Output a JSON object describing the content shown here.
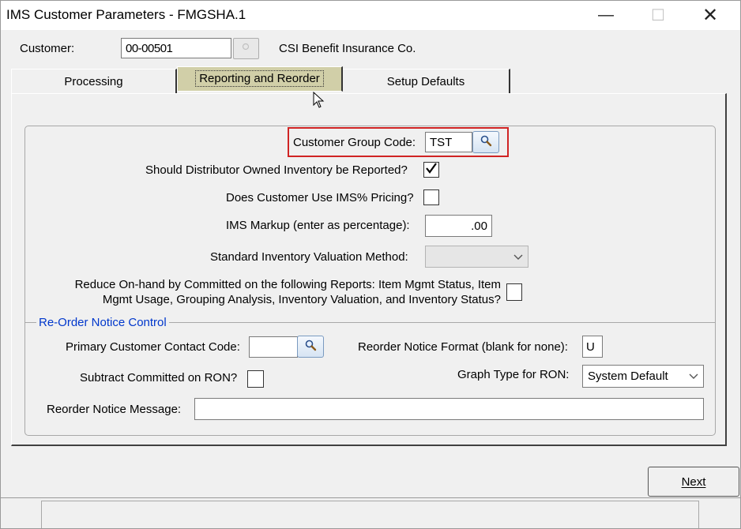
{
  "window": {
    "title": "IMS Customer Parameters - FMGSHA.1",
    "minimize_glyph": "—",
    "maximize_glyph": "☐",
    "close_glyph": "✕"
  },
  "customer": {
    "label": "Customer:",
    "code": "00-00501",
    "name": "CSI Benefit Insurance Co."
  },
  "tabs": [
    {
      "label": "Processing",
      "active": false
    },
    {
      "label": "Reporting and Reorder",
      "active": true
    },
    {
      "label": "Setup Defaults",
      "active": false
    }
  ],
  "form": {
    "customer_group_code_label": "Customer Group Code:",
    "customer_group_code_value": "TST",
    "distributor_owned_label": "Should Distributor Owned Inventory be Reported?",
    "distributor_owned_checked": true,
    "ims_pricing_label": "Does Customer Use IMS% Pricing?",
    "ims_pricing_checked": false,
    "ims_markup_label": "IMS Markup (enter as percentage):",
    "ims_markup_value": ".00",
    "valuation_method_label": "Standard Inventory Valuation Method:",
    "valuation_method_value": "",
    "reduce_onhand_label_line1": "Reduce On-hand by Committed on the following Reports: Item Mgmt Status, Item",
    "reduce_onhand_label_line2": "Mgmt Usage, Grouping Analysis, Inventory Valuation, and Inventory Status?",
    "reduce_onhand_checked": false
  },
  "reorder": {
    "group_title": "Re-Order Notice Control",
    "primary_contact_label": "Primary Customer Contact Code:",
    "primary_contact_value": "",
    "notice_format_label": "Reorder Notice Format (blank for none):",
    "notice_format_value": "U",
    "subtract_committed_label": "Subtract Committed on RON?",
    "subtract_committed_checked": false,
    "graph_type_label": "Graph Type for RON:",
    "graph_type_value": "System Default",
    "message_label": "Reorder Notice Message:",
    "message_value": ""
  },
  "buttons": {
    "next_label": "Next"
  },
  "colors": {
    "active_tab": "#d1cfa8",
    "highlight": "#d02424",
    "group_title": "#0037cc"
  }
}
